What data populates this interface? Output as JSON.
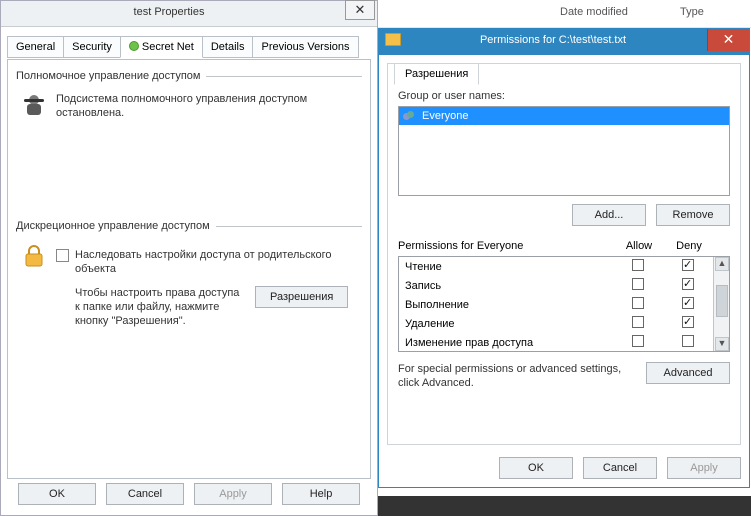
{
  "background": {
    "col_date": "Date modified",
    "col_type": "Type"
  },
  "properties": {
    "title": "test Properties",
    "tabs": {
      "general": "General",
      "security": "Security",
      "secretnet": "Secret Net",
      "details": "Details",
      "previous": "Previous Versions"
    },
    "group1": {
      "title": "Полномочное управление доступом",
      "line1": "Подсистема полномочного управления доступом",
      "line2": "остановлена."
    },
    "group2": {
      "title": "Дискреционное управление доступом",
      "inherit1": "Наследовать настройки доступа от родительского",
      "inherit2": "объекта",
      "hint1": "Чтобы настроить права доступа",
      "hint2": "к папке или файлу, нажмите",
      "hint3": "кнопку \"Разрешения\".",
      "perm_btn": "Разрешения"
    },
    "buttons": {
      "ok": "OK",
      "cancel": "Cancel",
      "apply": "Apply",
      "help": "Help"
    }
  },
  "permissions": {
    "title": "Permissions for C:\\test\\test.txt",
    "tab": "Разрешения",
    "group_label": "Group or user names:",
    "users": [
      {
        "name": "Everyone"
      }
    ],
    "add": "Add...",
    "remove": "Remove",
    "perm_for": "Permissions for Everyone",
    "allow": "Allow",
    "deny": "Deny",
    "rows": [
      {
        "name": "Чтение",
        "allow": false,
        "deny": true
      },
      {
        "name": "Запись",
        "allow": false,
        "deny": true
      },
      {
        "name": "Выполнение",
        "allow": false,
        "deny": true
      },
      {
        "name": "Удаление",
        "allow": false,
        "deny": true
      },
      {
        "name": "Изменение прав доступа",
        "allow": false,
        "deny": false
      }
    ],
    "advanced_text": "For special permissions or advanced settings, click Advanced.",
    "advanced_btn": "Advanced",
    "ok": "OK",
    "cancel": "Cancel",
    "apply": "Apply"
  }
}
